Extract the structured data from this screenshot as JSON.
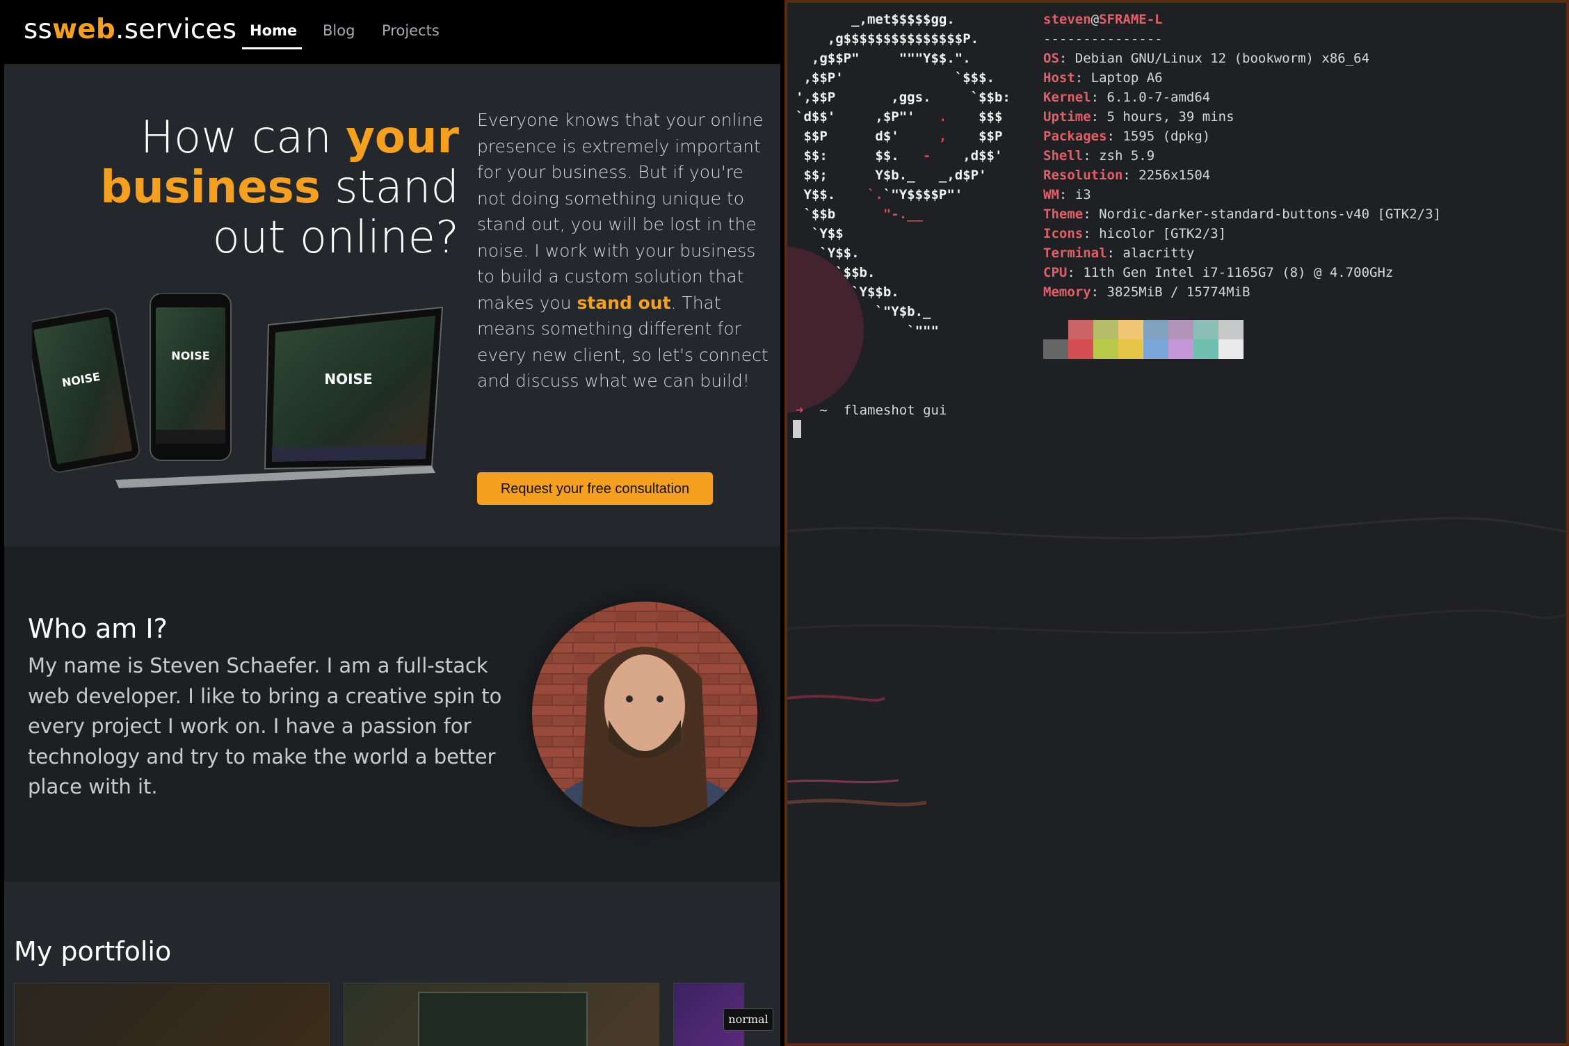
{
  "browser": {
    "nav": {
      "brand_prefix": "ss",
      "brand_accent": "web",
      "brand_suffix": ".services",
      "links": [
        {
          "label": "Home",
          "active": true
        },
        {
          "label": "Blog",
          "active": false
        },
        {
          "label": "Projects",
          "active": false
        }
      ]
    },
    "hero": {
      "heading_part1": "How can ",
      "heading_accent1": "your",
      "heading_accent2": "business",
      "heading_part2": " stand out online?",
      "text_part1": "Everyone knows that your online presence is extremely important for your business. But if you're not doing something unique to stand out, you will be lost in the noise. I work with your business to build a custom solution that makes you ",
      "text_accent": "stand out",
      "text_part2": ". That means something different for every new client, so let's connect and discuss what we can build!",
      "cta_label": "Request your free consultation"
    },
    "about": {
      "title": "Who am I?",
      "text": "My name is Steven Schaefer. I am a full-stack web developer. I like to bring a creative spin to every project I work on. I have a passion for technology and try to make the world a better place with it."
    },
    "portfolio": {
      "title": "My portfolio"
    },
    "mode_badge": "normal",
    "accent_color": "#f5a020"
  },
  "terminal": {
    "user": "steven",
    "at": "@",
    "host": "SFRAME-L",
    "separator": "---------------",
    "info": [
      {
        "key": "OS",
        "value": "Debian GNU/Linux 12 (bookworm) x86_64"
      },
      {
        "key": "Host",
        "value": "Laptop A6"
      },
      {
        "key": "Kernel",
        "value": "6.1.0-7-amd64"
      },
      {
        "key": "Uptime",
        "value": "5 hours, 39 mins"
      },
      {
        "key": "Packages",
        "value": "1595 (dpkg)"
      },
      {
        "key": "Shell",
        "value": "zsh 5.9"
      },
      {
        "key": "Resolution",
        "value": "2256x1504"
      },
      {
        "key": "WM",
        "value": "i3"
      },
      {
        "key": "Theme",
        "value": "Nordic-darker-standard-buttons-v40 [GTK2/3]"
      },
      {
        "key": "Icons",
        "value": "hicolor [GTK2/3]"
      },
      {
        "key": "Terminal",
        "value": "alacritty"
      },
      {
        "key": "CPU",
        "value": "11th Gen Intel i7-1165G7 (8) @ 4.700GHz"
      },
      {
        "key": "Memory",
        "value": "3825MiB / 15774MiB"
      }
    ],
    "palette_row1": [
      "#1f2024",
      "#cc6666",
      "#b5bd68",
      "#f0c674",
      "#81a2be",
      "#b294bb",
      "#8abeb7",
      "#c5c8c6"
    ],
    "palette_row2": [
      "#666666",
      "#d54e53",
      "#b9ca4a",
      "#e7c547",
      "#7aa6da",
      "#c397d8",
      "#70c0b1",
      "#eaeaea"
    ],
    "prompt_arrow": "➜",
    "prompt_dir": "~",
    "command": "flameshot gui"
  }
}
